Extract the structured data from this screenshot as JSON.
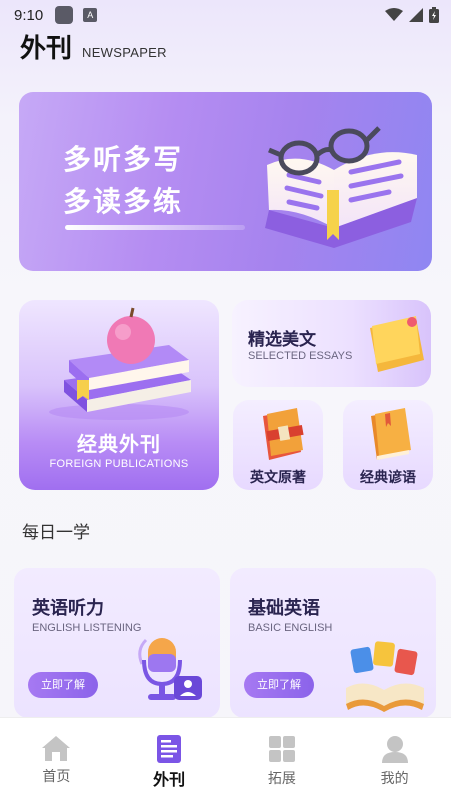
{
  "status_bar": {
    "time": "9:10",
    "a_glyph": "A"
  },
  "header": {
    "title": "外刊",
    "subtitle": "NEWSPAPER"
  },
  "banner": {
    "line1": "多听多写",
    "line2": "多读多练"
  },
  "cards": {
    "foreign": {
      "title": "经典外刊",
      "subtitle": "FOREIGN PUBLICATIONS"
    },
    "essays": {
      "title": "精选美文",
      "subtitle": "SELECTED ESSAYS"
    },
    "originals": {
      "title": "英文原著"
    },
    "proverbs": {
      "title": "经典谚语"
    }
  },
  "daily": {
    "section_title": "每日一学",
    "items": [
      {
        "title": "英语听力",
        "subtitle": "ENGLISH LISTENING",
        "button": "立即了解"
      },
      {
        "title": "基础英语",
        "subtitle": "BASIC ENGLISH",
        "button": "立即了解"
      }
    ]
  },
  "tabs": [
    {
      "label": "首页",
      "icon": "home-icon"
    },
    {
      "label": "外刊",
      "icon": "newspaper-icon"
    },
    {
      "label": "拓展",
      "icon": "grid-icon"
    },
    {
      "label": "我的",
      "icon": "person-icon"
    }
  ],
  "colors": {
    "accent": "#8b63ea",
    "active_tab": "#7b55e6",
    "inactive_icon": "#bdbdbd"
  }
}
